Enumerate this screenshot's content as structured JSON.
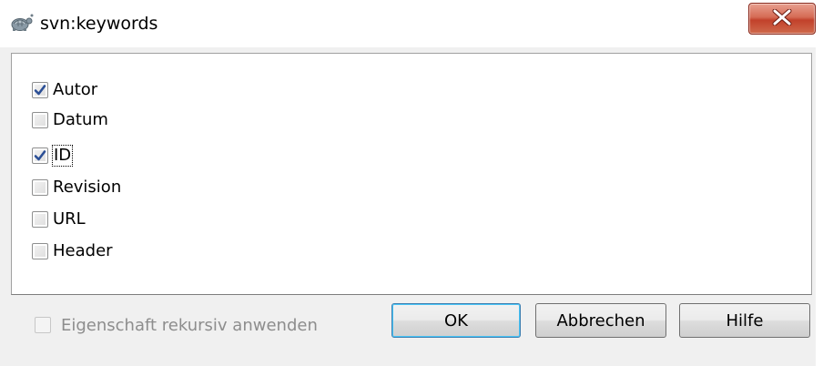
{
  "window": {
    "title": "svn:keywords",
    "app_icon": "tortoisesvn-icon",
    "close_icon": "close-icon"
  },
  "keywords": [
    {
      "label": "Autor",
      "checked": true
    },
    {
      "label": "Datum",
      "checked": false
    },
    {
      "label": "ID",
      "checked": true,
      "focused": true
    },
    {
      "label": "Revision",
      "checked": false
    },
    {
      "label": "URL",
      "checked": false
    },
    {
      "label": "Header",
      "checked": false
    }
  ],
  "recursive": {
    "label": "Eigenschaft rekursiv anwenden",
    "checked": false,
    "enabled": false
  },
  "buttons": {
    "ok": "OK",
    "cancel": "Abbrechen",
    "help": "Hilfe"
  },
  "colors": {
    "close_button": "#c7432d",
    "check_mark": "#2b4f96",
    "default_button_border": "#3c7fb1"
  }
}
